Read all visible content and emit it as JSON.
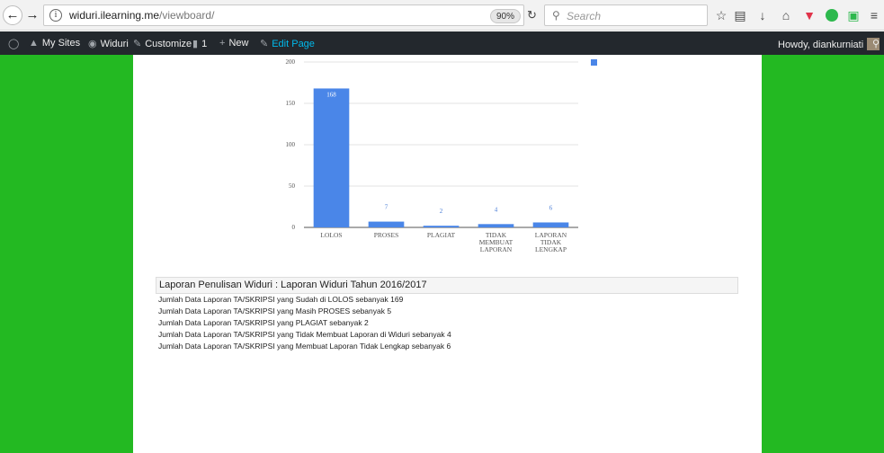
{
  "browser": {
    "url_host": "widuri.ilearning.me",
    "url_path": "/viewboard/",
    "zoom": "90%",
    "search_placeholder": "Search"
  },
  "admin_bar": {
    "my_sites": "My Sites",
    "site_name": "Widuri",
    "customize": "Customize",
    "comments_count": "1",
    "new": "New",
    "edit_page": "Edit Page",
    "greeting": "Howdy, diankurniati"
  },
  "chart_data": {
    "type": "bar",
    "categories": [
      "LOLOS",
      "PROSES",
      "PLAGIAT",
      "TIDAK MEMBUAT LAPORAN",
      "LAPORAN TIDAK LENGKAP"
    ],
    "values": [
      168,
      7,
      2,
      4,
      6
    ],
    "ylim": [
      0,
      200
    ],
    "yticks": [
      0,
      50,
      100,
      150,
      200
    ],
    "grid": true,
    "legend": "top-right",
    "color": "#4a86e8"
  },
  "report": {
    "heading": "Laporan Penulisan Widuri : Laporan Widuri Tahun 2016/2017",
    "lines": [
      "Jumlah Data Laporan TA/SKRIPSI yang Sudah di LOLOS sebanyak 169",
      "Jumlah Data Laporan TA/SKRIPSI yang Masih PROSES sebanyak 5",
      "Jumlah Data Laporan TA/SKRIPSI yang PLAGIAT sebanyak 2",
      "Jumlah Data Laporan TA/SKRIPSI yang Tidak Membuat Laporan di Widuri sebanyak 4",
      "Jumlah Data Laporan TA/SKRIPSI yang Membuat Laporan Tidak Lengkap sebanyak 6"
    ]
  }
}
